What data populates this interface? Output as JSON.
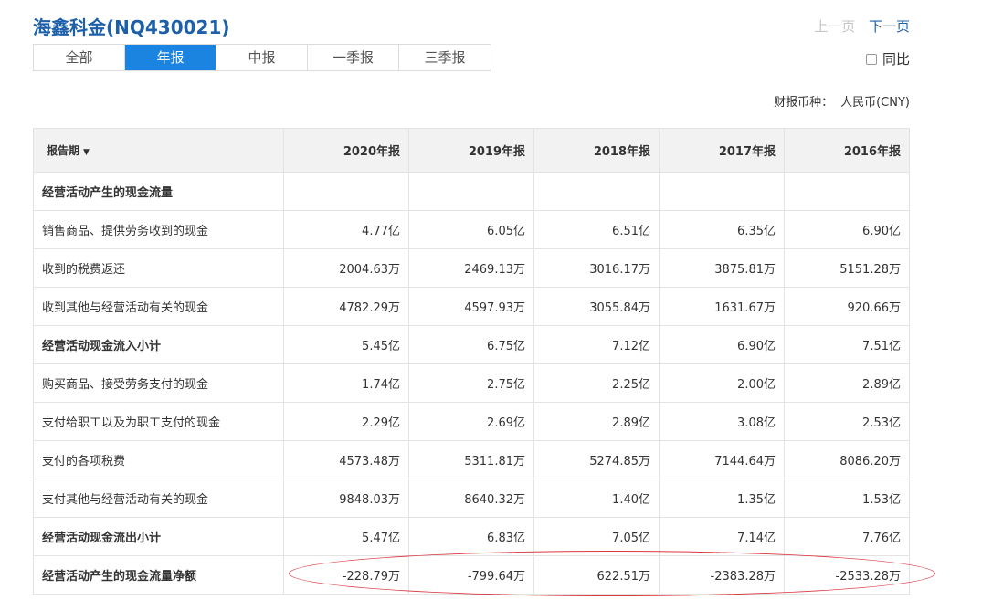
{
  "title": "海鑫科金(NQ430021)",
  "pager": {
    "prev": "上一页",
    "next": "下一页"
  },
  "tabs": [
    {
      "label": "全部"
    },
    {
      "label": "年报"
    },
    {
      "label": "中报"
    },
    {
      "label": "一季报"
    },
    {
      "label": "三季报"
    }
  ],
  "active_tab": "年报",
  "compare": {
    "label": "同比",
    "checked": false
  },
  "currency": {
    "label": "财报币种：",
    "value": "人民币(CNY)"
  },
  "table": {
    "header_label": "报告期",
    "columns": [
      "2020年报",
      "2019年报",
      "2018年报",
      "2017年报",
      "2016年报"
    ],
    "rows": [
      {
        "label": "经营活动产生的现金流量",
        "bold": true,
        "values": [
          "",
          "",
          "",
          "",
          ""
        ]
      },
      {
        "label": "销售商品、提供劳务收到的现金",
        "bold": false,
        "values": [
          "4.77亿",
          "6.05亿",
          "6.51亿",
          "6.35亿",
          "6.90亿"
        ]
      },
      {
        "label": "收到的税费返还",
        "bold": false,
        "values": [
          "2004.63万",
          "2469.13万",
          "3016.17万",
          "3875.81万",
          "5151.28万"
        ]
      },
      {
        "label": "收到其他与经营活动有关的现金",
        "bold": false,
        "values": [
          "4782.29万",
          "4597.93万",
          "3055.84万",
          "1631.67万",
          "920.66万"
        ]
      },
      {
        "label": "经营活动现金流入小计",
        "bold": true,
        "values": [
          "5.45亿",
          "6.75亿",
          "7.12亿",
          "6.90亿",
          "7.51亿"
        ]
      },
      {
        "label": "购买商品、接受劳务支付的现金",
        "bold": false,
        "values": [
          "1.74亿",
          "2.75亿",
          "2.25亿",
          "2.00亿",
          "2.89亿"
        ]
      },
      {
        "label": "支付给职工以及为职工支付的现金",
        "bold": false,
        "values": [
          "2.29亿",
          "2.69亿",
          "2.89亿",
          "3.08亿",
          "2.53亿"
        ]
      },
      {
        "label": "支付的各项税费",
        "bold": false,
        "values": [
          "4573.48万",
          "5311.81万",
          "5274.85万",
          "7144.64万",
          "8086.20万"
        ]
      },
      {
        "label": "支付其他与经营活动有关的现金",
        "bold": false,
        "values": [
          "9848.03万",
          "8640.32万",
          "1.40亿",
          "1.35亿",
          "1.53亿"
        ]
      },
      {
        "label": "经营活动现金流出小计",
        "bold": true,
        "values": [
          "5.47亿",
          "6.83亿",
          "7.05亿",
          "7.14亿",
          "7.76亿"
        ]
      },
      {
        "label": "经营活动产生的现金流量净额",
        "bold": true,
        "values": [
          "-228.79万",
          "-799.64万",
          "622.51万",
          "-2383.28万",
          "-2533.28万"
        ]
      }
    ]
  },
  "colors": {
    "brand_blue": "#1d5fa8",
    "active_tab": "#1b84e0",
    "annotation_red": "#d9363e"
  }
}
